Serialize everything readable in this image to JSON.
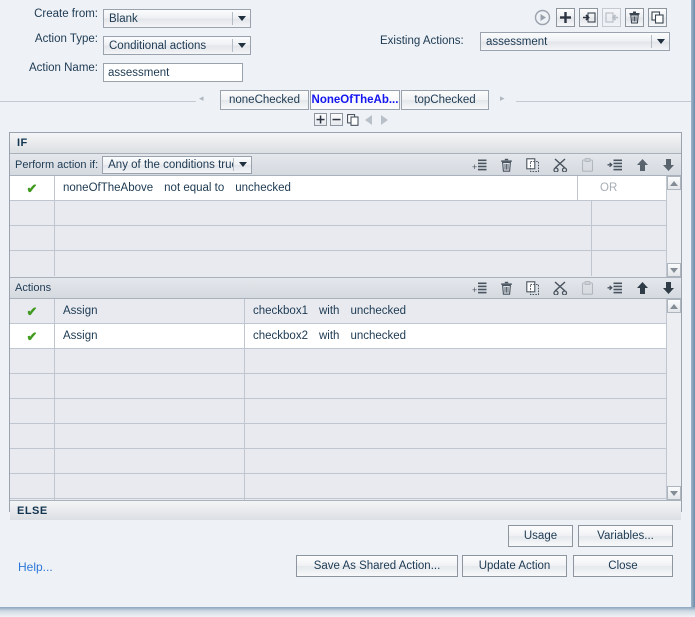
{
  "form": {
    "create_from_label": "Create from:",
    "create_from_value": "Blank",
    "action_type_label": "Action Type:",
    "action_type_value": "Conditional actions",
    "action_name_label": "Action Name:",
    "action_name_value": "assessment",
    "existing_actions_label": "Existing Actions:",
    "existing_actions_value": "assessment"
  },
  "top_toolbar": {
    "preview": "preview-icon",
    "add": "add-icon",
    "export": "export-icon",
    "import": "import-icon",
    "delete": "delete-icon",
    "duplicate": "duplicate-icon"
  },
  "tabs": {
    "items": [
      {
        "label": "noneChecked",
        "active": false
      },
      {
        "label": "NoneOfTheAb...",
        "active": true
      },
      {
        "label": "topChecked",
        "active": false
      }
    ],
    "controls": {
      "add": "+",
      "remove": "–",
      "duplicate": "duplicate-icon",
      "prev": "prev-icon",
      "next": "next-icon"
    }
  },
  "if_section": {
    "header": "IF",
    "perform_label": "Perform action if:",
    "perform_value": "Any of the conditions true",
    "rows": [
      {
        "enabled": true,
        "variable": "noneOfTheAbove",
        "operator": "not equal to",
        "value": "unchecked",
        "join": "OR"
      }
    ],
    "empty_rows": 3
  },
  "actions_section": {
    "header": "Actions",
    "rows": [
      {
        "enabled": true,
        "action": "Assign",
        "target": "checkbox1",
        "connector": "with",
        "value": "unchecked"
      },
      {
        "enabled": true,
        "action": "Assign",
        "target": "checkbox2",
        "connector": "with",
        "value": "unchecked"
      }
    ],
    "empty_rows": 7
  },
  "else_section": {
    "header": "ELSE"
  },
  "row_toolbar": {
    "add_row": "add-row-icon",
    "delete_row": "trash-icon",
    "copy_row": "copy-icon",
    "cut_row": "scissors-icon",
    "paste_row": "paste-icon",
    "insert_row": "insert-row-icon",
    "move_up": "arrow-up-icon",
    "move_down": "arrow-down-icon"
  },
  "footer": {
    "help": "Help...",
    "usage": "Usage",
    "variables": "Variables...",
    "save_as_shared": "Save As Shared Action...",
    "update_action": "Update Action",
    "close": "Close"
  },
  "colors": {
    "accent_blue": "#1515ef",
    "link_blue": "#2d78d8",
    "check_green": "#3f9a1e",
    "panel_bg": "#eef1f6"
  }
}
